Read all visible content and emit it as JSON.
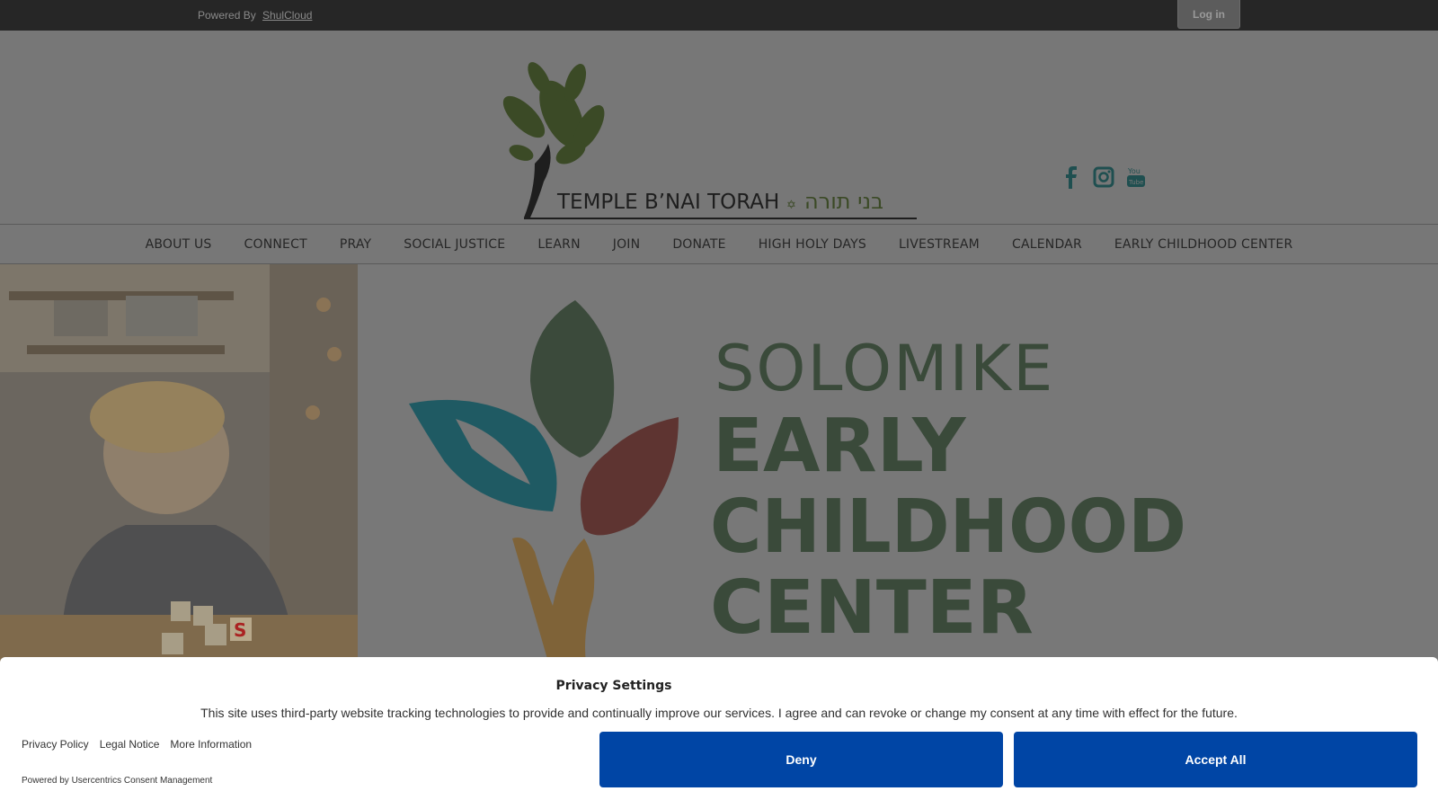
{
  "topbar": {
    "powered_by": "Powered By",
    "powered_link": "ShulCloud",
    "login_label": "Log in"
  },
  "header": {
    "logo_text": "TEMPLE B’NAI TORAH",
    "logo_hebrew": "בני תורה",
    "social_icons": [
      "facebook-icon",
      "instagram-icon",
      "youtube-icon"
    ]
  },
  "nav": {
    "items": [
      "ABOUT US",
      "CONNECT",
      "PRAY",
      "SOCIAL JUSTICE",
      "LEARN",
      "JOIN",
      "DONATE",
      "HIGH HOLY DAYS",
      "LIVESTREAM",
      "CALENDAR",
      "EARLY CHILDHOOD CENTER"
    ]
  },
  "hero": {
    "line1": "SOLOMIKE",
    "line2": "EARLY",
    "line3": "CHILDHOOD",
    "line4": "CENTER"
  },
  "consent": {
    "title": "Privacy Settings",
    "text": "This site uses third-party website tracking technologies to provide and continually improve our services. I agree and can revoke or change my consent at any time with effect for the future.",
    "links": [
      "Privacy Policy",
      "Legal Notice",
      "More Information"
    ],
    "powered": "Powered by Usercentrics Consent Management",
    "deny_label": "Deny",
    "accept_label": "Accept All"
  },
  "colors": {
    "button": "#0045a5",
    "overlay_bg": "#777777",
    "social_teal": "#1f6a6c"
  }
}
